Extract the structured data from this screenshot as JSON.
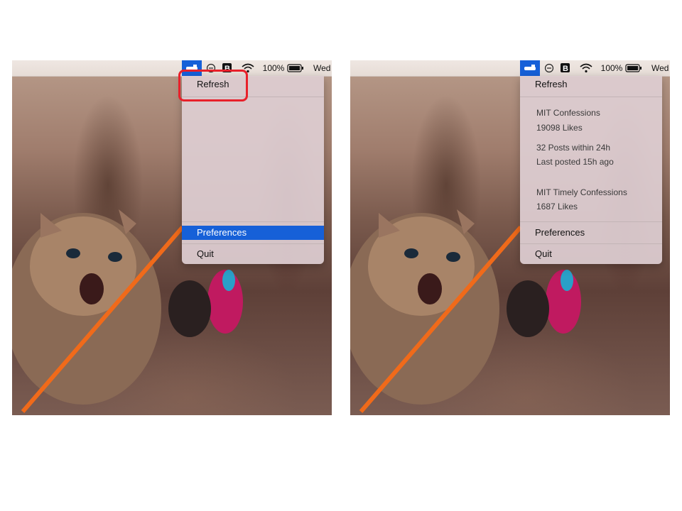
{
  "menubar": {
    "battery_percent": "100%",
    "clock": "Wed"
  },
  "left_panel": {
    "menu": {
      "refresh": "Refresh",
      "preferences": "Preferences",
      "quit": "Quit"
    },
    "selected_item": "Preferences"
  },
  "right_panel": {
    "menu": {
      "refresh": "Refresh",
      "preferences": "Preferences",
      "quit": "Quit"
    },
    "pages": [
      {
        "name": "MIT Confessions",
        "likes": "19098 Likes"
      },
      {
        "name": "MIT Timely Confessions",
        "likes": "1687 Likes"
      }
    ],
    "stats": {
      "posts": "32 Posts within 24h",
      "last_posted": "Last posted 15h ago"
    }
  },
  "colors": {
    "accent": "#1660d8",
    "highlight_box": "#e8202a",
    "menu_background": "#decece"
  },
  "icons": [
    "app-status-icon",
    "do-not-disturb-icon",
    "bartender-icon",
    "wifi-icon",
    "battery-icon"
  ]
}
